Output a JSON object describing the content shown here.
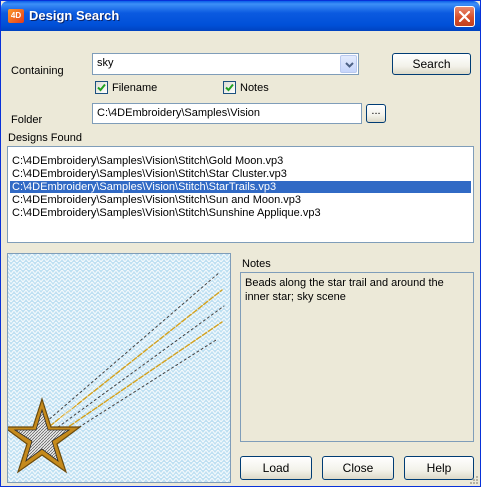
{
  "window": {
    "title": "Design Search",
    "app_icon_text": "4D"
  },
  "containing": {
    "label": "Containing",
    "value": "sky"
  },
  "search_button": "Search",
  "filename_checkbox": {
    "label": "Filename",
    "checked": true
  },
  "notes_checkbox": {
    "label": "Notes",
    "checked": true
  },
  "folder": {
    "label": "Folder",
    "value": "C:\\4DEmbroidery\\Samples\\Vision",
    "browse_label": "..."
  },
  "designs_found": {
    "label": "Designs Found",
    "items": [
      "C:\\4DEmbroidery\\Samples\\Vision\\Stitch\\Gold Moon.vp3",
      "C:\\4DEmbroidery\\Samples\\Vision\\Stitch\\Star Cluster.vp3",
      "C:\\4DEmbroidery\\Samples\\Vision\\Stitch\\StarTrails.vp3",
      "C:\\4DEmbroidery\\Samples\\Vision\\Stitch\\Sun and Moon.vp3",
      "C:\\4DEmbroidery\\Samples\\Vision\\Stitch\\Sunshine Applique.vp3"
    ],
    "selected_index": 2
  },
  "notes": {
    "label": "Notes",
    "text": "Beads along the star trail and around the inner star; sky scene"
  },
  "buttons": {
    "load": "Load",
    "close": "Close",
    "help": "Help"
  },
  "colors": {
    "title_bar": "#0054e3",
    "selection": "#316ac5",
    "dialog_bg": "#ece9d8",
    "field_border": "#7f9db9"
  }
}
